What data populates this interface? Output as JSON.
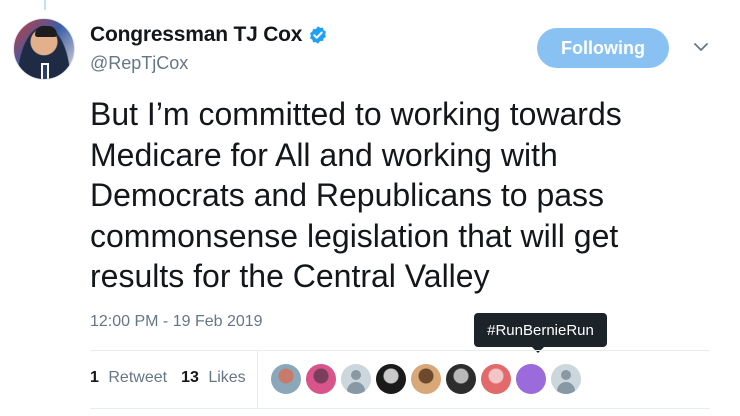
{
  "author": {
    "display_name": "Congressman TJ Cox",
    "handle": "@RepTjCox",
    "verified": true
  },
  "follow_button": {
    "label": "Following",
    "color": "#88c1f2"
  },
  "tweet": {
    "lines": [
      "But I’m committed to working towards",
      "Medicare for All and  working with",
      "Democrats and Republicans to pass",
      "commonsense legislation that will get",
      "results for the Central Valley"
    ],
    "timestamp": "12:00 PM - 19 Feb 2019"
  },
  "tooltip": {
    "text": "#RunBernieRun"
  },
  "stats": {
    "retweets_count": "1",
    "retweets_label": "Retweet",
    "likes_count": "13",
    "likes_label": "Likes"
  },
  "likers": [
    {
      "name": "liker-avatar-1",
      "colors": [
        "#8aa8b9",
        "#c77a6a"
      ]
    },
    {
      "name": "liker-avatar-2",
      "colors": [
        "#d9548a",
        "#7a3d5e"
      ]
    },
    {
      "name": "liker-avatar-3",
      "colors": [
        "default"
      ]
    },
    {
      "name": "liker-avatar-4",
      "colors": [
        "#1a1a1a",
        "#c9c9c9"
      ]
    },
    {
      "name": "liker-avatar-5",
      "colors": [
        "#d8a878",
        "#6b4a2e"
      ]
    },
    {
      "name": "liker-avatar-6",
      "colors": [
        "#2d2d2d",
        "#b8b8b8"
      ]
    },
    {
      "name": "liker-avatar-7",
      "colors": [
        "#e26a6a",
        "#f2c6c6"
      ]
    },
    {
      "name": "liker-avatar-8",
      "colors": [
        "#9b6bdc",
        "#9b6bdc"
      ]
    },
    {
      "name": "liker-avatar-9",
      "colors": [
        "default"
      ]
    }
  ]
}
